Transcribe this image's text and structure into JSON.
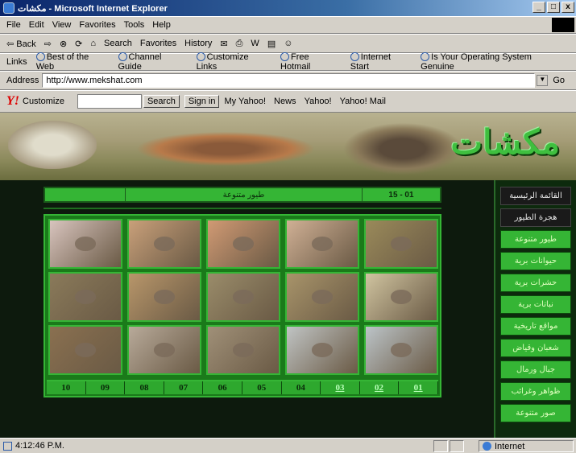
{
  "window": {
    "title": "مكشات - Microsoft Internet Explorer",
    "controls": [
      "_",
      "□",
      "x"
    ]
  },
  "menu": [
    "File",
    "Edit",
    "View",
    "Favorites",
    "Tools",
    "Help"
  ],
  "toolbar": {
    "back": "⇦ Back",
    "forward": "⇨",
    "stop": "⊗",
    "refresh": "⟳",
    "home": "⌂",
    "search": "Search",
    "favorites": "Favorites",
    "history": "History",
    "mail": "✉",
    "print": "⎙",
    "edit": "W",
    "discuss": "▤",
    "messenger": "☺"
  },
  "links": {
    "label": "Links",
    "items": [
      "Best of the Web",
      "Channel Guide",
      "Customize Links",
      "Free Hotmail",
      "Internet Start",
      "Is Your Operating System Genuine"
    ]
  },
  "address": {
    "label": "Address",
    "url": "http://www.mekshat.com",
    "go": "Go"
  },
  "yahoo": {
    "logo": "Y!",
    "customize": "Customize",
    "search_button": "Search",
    "sign_in": "Sign in",
    "my_yahoo": "My Yahoo!",
    "news": "News",
    "yahoo": "Yahoo!",
    "mail": "Yahoo! Mail"
  },
  "site": {
    "logo": "مكشات",
    "header": {
      "blank": "",
      "section": "طيور متنوعة",
      "range": "15 - 01"
    },
    "thumb_colors": [
      "#d8c4be",
      "#c9a07a",
      "#d19a74",
      "#d0b095",
      "#9a8a5a",
      "#8a7a5a",
      "#b8966a",
      "#9a8c6a",
      "#a8946a",
      "#d0c4a0",
      "#8a7050",
      "#b8aa9a",
      "#a09078",
      "#c0c4c4",
      "#bcc4c8"
    ],
    "pages": [
      "10",
      "09",
      "08",
      "07",
      "06",
      "05",
      "04",
      "03",
      "02",
      "01"
    ],
    "nav": [
      {
        "label": "القائمة الرئيسية",
        "style": "dark"
      },
      {
        "label": "هجرة الطيور",
        "style": "dark"
      },
      {
        "label": "طيور متنوعة",
        "style": "green"
      },
      {
        "label": "حيوانات برية",
        "style": "green"
      },
      {
        "label": "حشرات برية",
        "style": "green"
      },
      {
        "label": "نباتات برية",
        "style": "green"
      },
      {
        "label": "مواقع تاريخية",
        "style": "green"
      },
      {
        "label": "شعبان وقياض",
        "style": "green"
      },
      {
        "label": "جبال ورمال",
        "style": "green"
      },
      {
        "label": "ظواهر وغرائب",
        "style": "green"
      },
      {
        "label": "صور متنوعة",
        "style": "green"
      }
    ]
  },
  "status": {
    "text": "4:12:46 P.M.",
    "zone": "Internet"
  }
}
